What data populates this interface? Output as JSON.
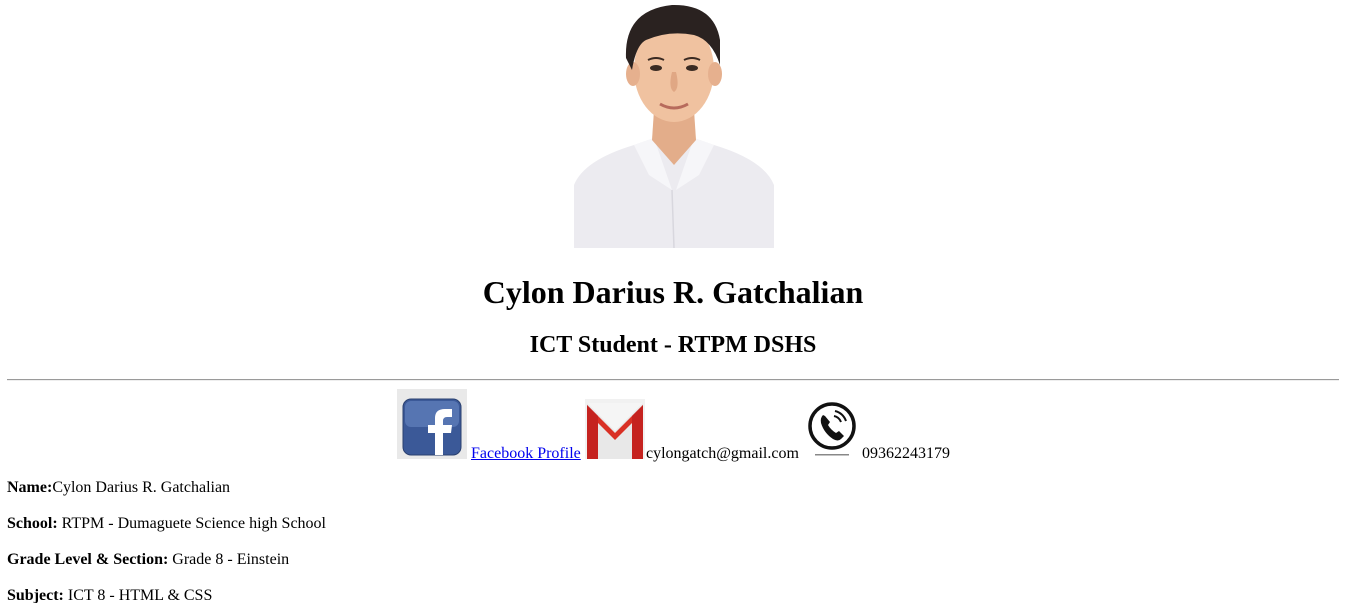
{
  "profile": {
    "name_heading": "Cylon Darius R. Gatchalian",
    "subtitle": "ICT Student - RTPM DSHS"
  },
  "contacts": {
    "facebook_label": "Facebook Profile ",
    "email": "cylongatch@gmail.com",
    "phone": "09362243179",
    "icons": [
      "facebook-icon",
      "gmail-icon",
      "phone-icon"
    ]
  },
  "details": [
    {
      "label": "Name:",
      "value": "Cylon Darius R. Gatchalian"
    },
    {
      "label": "School:",
      "value": " RTPM - Dumaguete Science high School"
    },
    {
      "label": "Grade Level & Section:",
      "value": " Grade 8 - Einstein"
    },
    {
      "label": "Subject:",
      "value": " ICT 8 - HTML & CSS"
    }
  ],
  "colors": {
    "link": "#0000ee",
    "facebook_blue": "#3b5998",
    "gmail_red": "#d93025",
    "divider": "#9a9a9a"
  }
}
